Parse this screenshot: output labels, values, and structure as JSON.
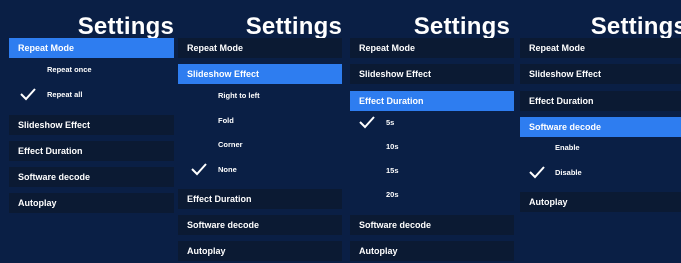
{
  "colors": {
    "background": "#0a1f45",
    "item": "#0b1a33",
    "active": "#2e7df0",
    "text": "#ffffff"
  },
  "panels": [
    {
      "title": "Settings",
      "menu": [
        "Repeat Mode",
        "Slideshow Effect",
        "Effect Duration",
        "Software decode",
        "Autoplay"
      ],
      "expanded": "Repeat Mode",
      "options": [
        "Repeat once",
        "Repeat all"
      ],
      "selected": "Repeat all"
    },
    {
      "title": "Settings",
      "menu": [
        "Repeat Mode",
        "Slideshow Effect",
        "Effect Duration",
        "Software decode",
        "Autoplay"
      ],
      "expanded": "Slideshow Effect",
      "options": [
        "Right to left",
        "Fold",
        "Corner",
        "None"
      ],
      "selected": "None"
    },
    {
      "title": "Settings",
      "menu": [
        "Repeat Mode",
        "Slideshow Effect",
        "Effect Duration",
        "Software decode",
        "Autoplay"
      ],
      "expanded": "Effect Duration",
      "options": [
        "5s",
        "10s",
        "15s",
        "20s"
      ],
      "selected": "5s"
    },
    {
      "title": "Settings",
      "menu": [
        "Repeat Mode",
        "Slideshow Effect",
        "Effect Duration",
        "Software decode",
        "Autoplay"
      ],
      "expanded": "Software decode",
      "options": [
        "Enable",
        "Disable"
      ],
      "selected": "Disable"
    }
  ]
}
